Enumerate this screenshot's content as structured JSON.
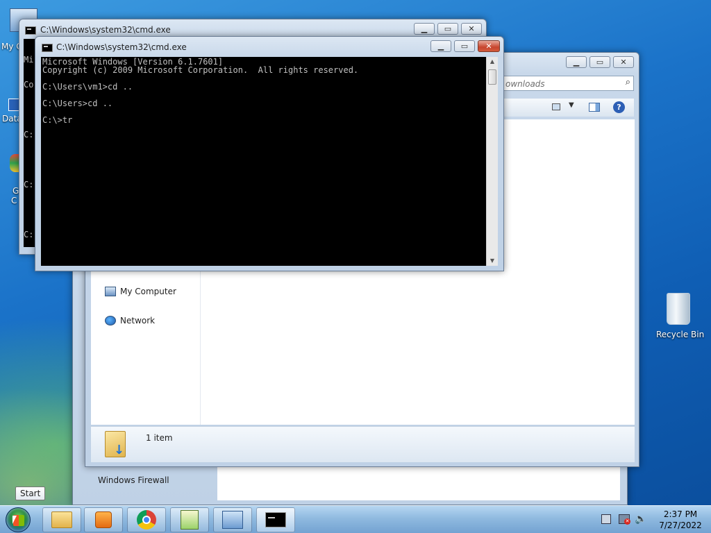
{
  "desktop": {
    "icons": {
      "my_computer_partial": "My C",
      "data_partial": "Data",
      "g_partial": "G",
      "c_partial": "C",
      "recycle_bin": "Recycle Bin"
    }
  },
  "cmd_back": {
    "title": "C:\\Windows\\system32\\cmd.exe",
    "lines": [
      "Mi",
      "Co",
      "",
      "C:",
      "",
      "C:",
      "",
      "C:"
    ]
  },
  "cmd_front": {
    "title": "C:\\Windows\\system32\\cmd.exe",
    "console_text": "Microsoft Windows [Version 6.1.7601]\nCopyright (c) 2009 Microsoft Corporation.  All rights reserved.\n\nC:\\Users\\vm1>cd ..\n\nC:\\Users>cd ..\n\nC:\\>tr"
  },
  "explorer": {
    "search_partial": "ownloads",
    "nav": {
      "my_computer": "My Computer",
      "network": "Network"
    },
    "status": {
      "item_count": "1 item"
    }
  },
  "back_window": {
    "firewall_label": "Windows Firewall"
  },
  "taskbar": {
    "start_tooltip": "Start",
    "clock_time": "2:37 PM",
    "clock_date": "7/27/2022"
  }
}
